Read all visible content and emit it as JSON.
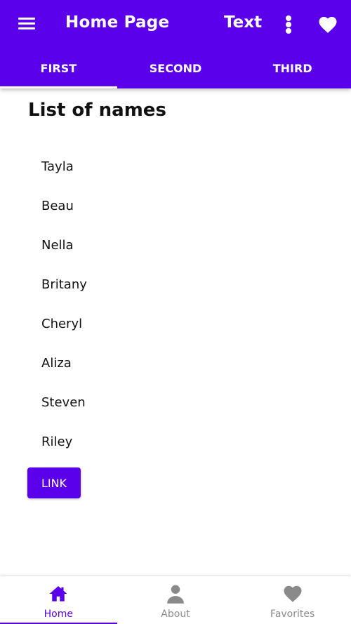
{
  "colors": {
    "primary": "#5b00ea",
    "inactive_nav": "#8a8a8a",
    "text": "#111111"
  },
  "appbar": {
    "title": "Home Page",
    "action_text": "Text",
    "icons": [
      "menu-icon",
      "more-vert-icon",
      "heart-icon"
    ]
  },
  "tabs": [
    {
      "label": "FIRST",
      "active": true
    },
    {
      "label": "SECOND",
      "active": false
    },
    {
      "label": "THIRD",
      "active": false
    }
  ],
  "main": {
    "heading": "List of names",
    "names": [
      "Tayla",
      "Beau",
      "Nella",
      "Britany",
      "Cheryl",
      "Aliza",
      "Steven",
      "Riley"
    ],
    "link_button": "LINK"
  },
  "bottom_nav": [
    {
      "label": "Home",
      "icon": "home-icon",
      "active": true
    },
    {
      "label": "About",
      "icon": "person-icon",
      "active": false
    },
    {
      "label": "Favorites",
      "icon": "heart-icon",
      "active": false
    }
  ]
}
